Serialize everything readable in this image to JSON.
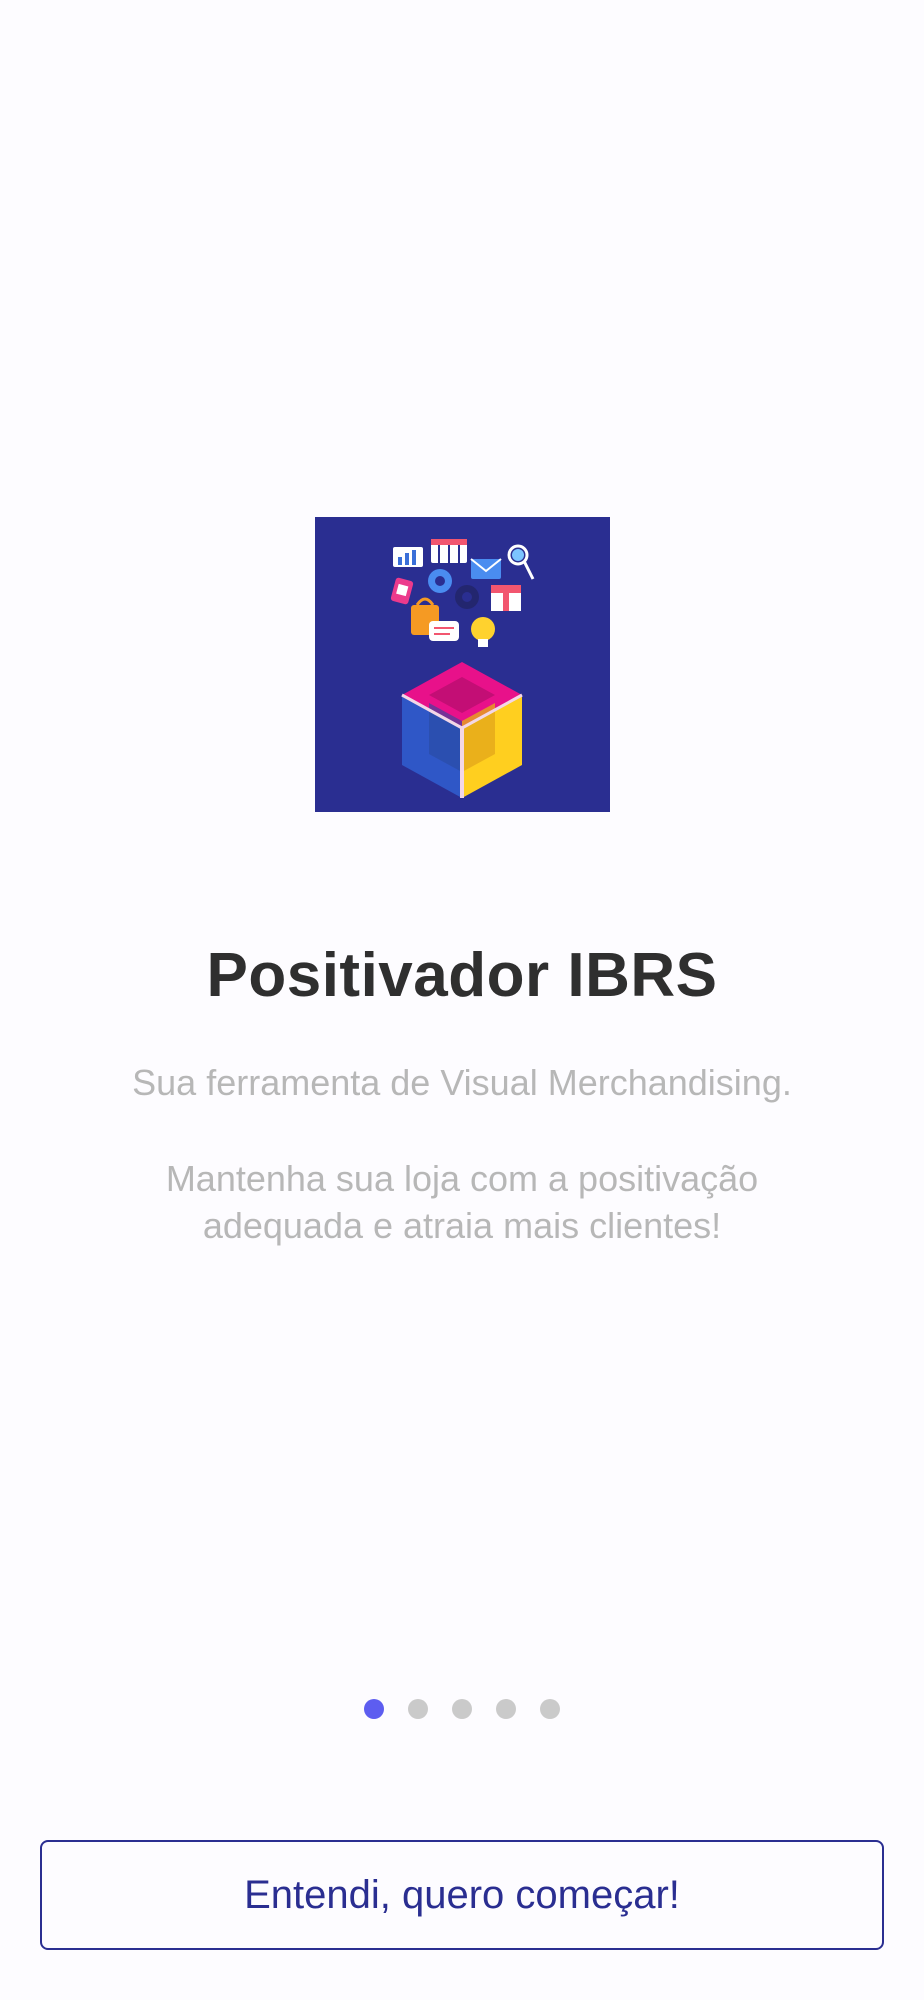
{
  "onboarding": {
    "logo_icon": "app-logo-box-icon",
    "title": "Positivador IBRS",
    "subtitle": "Sua ferramenta de Visual Merchandising.",
    "description": "Mantenha sua loja com a positivação adequada e atraia mais clientes!",
    "page_indicator": {
      "total": 5,
      "active": 1
    },
    "cta_label": "Entendi, quero começar!"
  },
  "colors": {
    "background": "#fdfcff",
    "brand": "#2a2e91",
    "dot_active": "#5d5df0",
    "dot_inactive": "#cacaca",
    "title": "#2f2f2f",
    "body_text": "#b7b7b7"
  }
}
